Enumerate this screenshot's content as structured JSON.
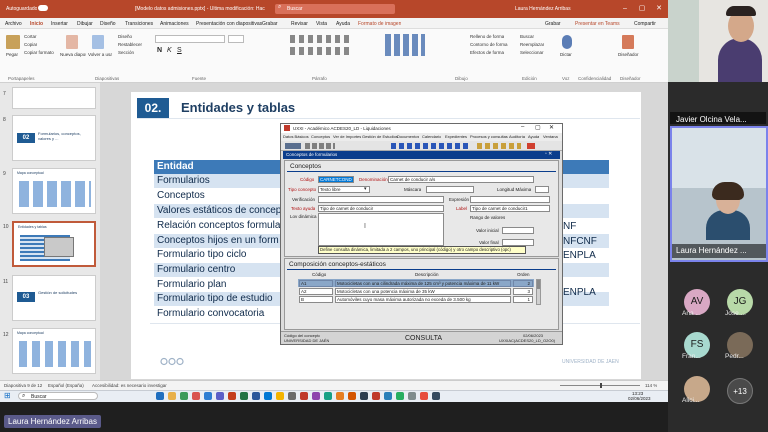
{
  "powerpoint": {
    "autosave_label": "Autoguardado",
    "file_title": "[Modelo datos admisiones.pptx] - Última modificación: Hace 2 h · Este PC",
    "search_placeholder": "Buscar",
    "user_name": "Laura Hernández Arribas",
    "menu": [
      "Archivo",
      "Inicio",
      "Insertar",
      "Dibujar",
      "Diseño",
      "Transiciones",
      "Animaciones",
      "Presentación con diapositivas",
      "Grabar",
      "Revisar",
      "Vista",
      "Ayuda",
      "Formato de imagen"
    ],
    "menu_right": {
      "record": "Grabar",
      "present": "Presentar en Teams",
      "share": "Compartir"
    },
    "ribbon": {
      "paste": "Pegar",
      "cut": "Cortar",
      "copy": "Copiar",
      "format": "Copiar formato",
      "new_slide": "Nueva diapositiva",
      "reuse": "Volver a usar diapositivas",
      "design": "Diseño",
      "reset": "Restablecer",
      "section": "Sección",
      "search": "Buscar",
      "replace": "Reemplazar",
      "select": "Seleccionar",
      "dictate": "Dictar",
      "designer": "Diseñador",
      "shape_fill": "Relleno de forma",
      "shape_outline": "Contorno de forma",
      "shape_effects": "Efectos de forma",
      "groups": [
        "Portapapeles",
        "Diapositivas",
        "Fuente",
        "Párrafo",
        "Dibujo",
        "Edición",
        "Voz",
        "Confidencialidad",
        "Diseñador"
      ]
    },
    "thumbnails": [
      {
        "num": "7",
        "title": ""
      },
      {
        "num": "8",
        "title": "Formularios, conceptos, valores y ..."
      },
      {
        "num": "9",
        "title": "Mapa conceptual"
      },
      {
        "num": "10",
        "title": "Entidades y tablas"
      },
      {
        "num": "11",
        "title": "Gestión de solicitudes"
      },
      {
        "num": "12",
        "title": "Mapa conceptual"
      }
    ],
    "thumb_badges": {
      "t8": "02",
      "t11": "03"
    },
    "status": {
      "slide": "Diapositiva 9 de 12",
      "lang": "Español (España)",
      "access": "Accesibilidad: es necesario investigar",
      "zoom": "114 %"
    },
    "taskbar_search": "Buscar",
    "clock": {
      "time": "13:23",
      "date": "02/06/2023"
    }
  },
  "slide": {
    "number": "02.",
    "title": "Entidades y tablas",
    "header_col": "Entidad",
    "rows": [
      "Formularios",
      "Conceptos",
      "Valores estáticos de concep",
      "Relación conceptos formula",
      "Conceptos hijos en un form",
      "Formulario tipo ciclo",
      "Formulario centro",
      "Formulario plan",
      "Formulario tipo de estudio",
      "Formulario convocatoria"
    ],
    "right_values": [
      "NF",
      "NFCNF",
      "ENPLA",
      "ENPLA"
    ],
    "footer": "UNIVERSIDAD DE JAÉN"
  },
  "uxxi": {
    "window_title": "UXXI - Académico ACDES20_LD - Liquidaciones",
    "menu": [
      "Datos Básicos",
      "Conceptos",
      "Ver de Importes",
      "Gestión de Estudios",
      "Documentos",
      "Calendario",
      "Expedientes",
      "Procesos y consultas",
      "Auditoría",
      "Ayuda",
      "Ventana"
    ],
    "subform_title": "Conceptos de formularios",
    "section_conceptos": "Conceptos",
    "codigo_label": "Código",
    "codigo_value": "CARNETCOND",
    "denominacion_label": "Denominación",
    "denominacion_value": "Carnet de conducir a/s",
    "tipo_label": "Tipo concepto",
    "tipo_value": "Texto libre",
    "mascara_label": "Máscara",
    "longitud_label": "Longitud Máxima",
    "verificacion_label": "Verificación",
    "expresion_label": "Expresión",
    "texto_ayuda_label": "Texto ayuda",
    "texto_ayuda_value": "Tipo de carnet de conducir",
    "label_label": "Label",
    "label_value": "Tipo de carnet de conducir1",
    "lov_label": "Lov dinámica",
    "rango_label": "Rango de valores",
    "valor_inicial_label": "Valor inicial",
    "valor_final_label": "Valor final",
    "tooltip": "Define consulta dinámica, limitada a 2 campos, uno principal (código) y otro campo descriptivo (opc)",
    "section_composicion": "Composición conceptos-estáticos",
    "cols": [
      "Código",
      "Descripción",
      "Orden"
    ],
    "rows": [
      {
        "code": "A1",
        "desc": "Motocicletas con una cilindrada máxima de 125 cm³ y potencia máxima de 11 kW",
        "order": "2"
      },
      {
        "code": "A2",
        "desc": "Motocicletas con una potencia máxima de 35 kW",
        "order": "3"
      },
      {
        "code": "B",
        "desc": "Automóviles cuyo masa máxima autorizada no exceda de 3.500 kg",
        "order": "1"
      }
    ],
    "status_left1": "Código del concepto",
    "status_left2": "UNIVERSIDAD DE JAÉN",
    "status_center": "CONSULTA",
    "status_right1": "02/06/2023",
    "status_right2": "UXXIAC(ACDES20_LD_O2O0)"
  },
  "participants": [
    {
      "name": "Javier Olcina Vela..."
    },
    {
      "name": "Laura Hernández ..."
    },
    {
      "initials": "AV",
      "short": "Ana ...",
      "color": "#d9a8c4"
    },
    {
      "initials": "JG",
      "short": "Jose ...",
      "color": "#b8d9a8"
    },
    {
      "initials": "FS",
      "short": "Fran...",
      "color": "#a8d9cf"
    },
    {
      "initials": "",
      "short": "Pedr...",
      "color": "#7a6a58"
    },
    {
      "initials": "",
      "short": "Alici...",
      "color": "#c7a88a"
    },
    {
      "initials": "+13",
      "short": "",
      "color": "#4a4a4a"
    }
  ],
  "presenter_name": "Laura Hernández Arribas",
  "colors": {
    "ppt_accent": "#b7472a",
    "slide_blue": "#1f5b93",
    "table_header": "#3d7ab8",
    "row_alt": "#d6e3f1",
    "uxxi_blue": "#0b3d8c"
  }
}
